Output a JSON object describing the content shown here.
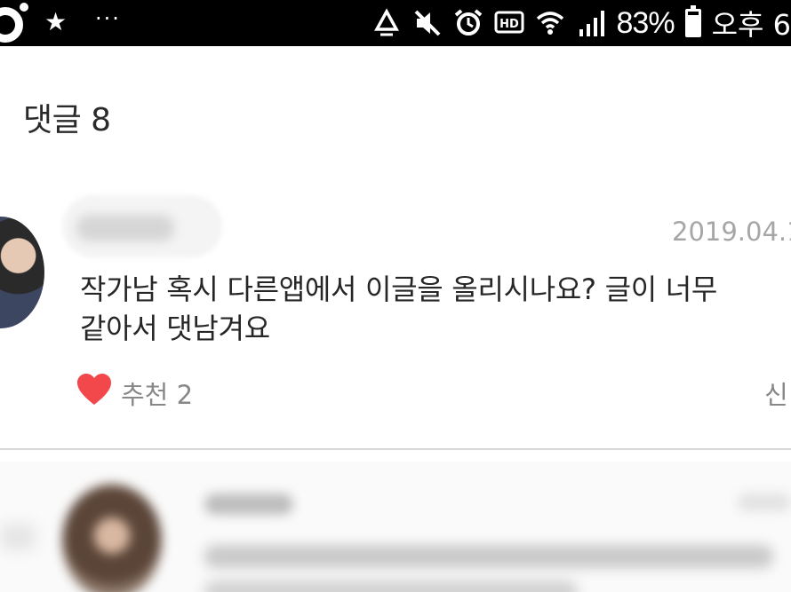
{
  "status_bar": {
    "battery_percent": "83%",
    "battery_level": 0.83,
    "time": "오후 6",
    "icons": [
      "ring-icon",
      "star-icon",
      "more-dots-icon",
      "recycle-icon",
      "mute-icon",
      "alarm-icon",
      "hd-icon",
      "wifi-icon",
      "signal-icon",
      "battery-icon"
    ]
  },
  "header": {
    "title": "댓글 8"
  },
  "comments": [
    {
      "date": "2019.04.1",
      "text_line1": "작가남 혹시 다른앱에서 이글을 올리시나요? 글이 너무",
      "text_line2": "같아서 댓남겨요",
      "like_label": "추천 2",
      "report_label": "신"
    }
  ],
  "colors": {
    "status_bar_bg": "#000000",
    "like_heart": "#f2484b",
    "muted_text": "#888888",
    "date_text": "#a6a6a6"
  }
}
